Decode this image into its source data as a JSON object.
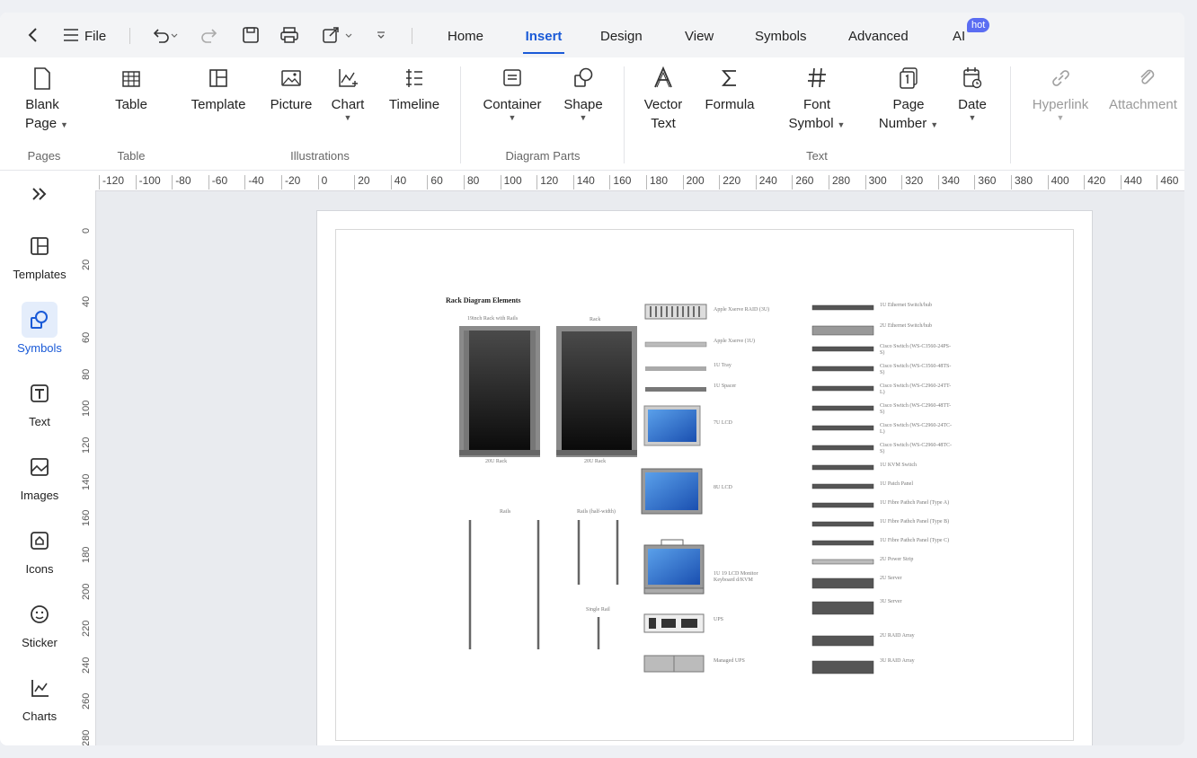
{
  "menubar": {
    "file_label": "File",
    "tabs": [
      {
        "label": "Home"
      },
      {
        "label": "Insert"
      },
      {
        "label": "Design"
      },
      {
        "label": "View"
      },
      {
        "label": "Symbols"
      },
      {
        "label": "Advanced"
      },
      {
        "label": "AI"
      }
    ],
    "hot_badge": "hot"
  },
  "ribbon": {
    "blank_page": [
      "Blank",
      "Page"
    ],
    "table": "Table",
    "template": "Template",
    "picture": "Picture",
    "chart": "Chart",
    "timeline": "Timeline",
    "container": "Container",
    "shape": "Shape",
    "vector_text": [
      "Vector",
      "Text"
    ],
    "formula": "Formula",
    "font_symbol": [
      "Font",
      "Symbol"
    ],
    "page_number": [
      "Page",
      "Number"
    ],
    "date": "Date",
    "hyperlink": "Hyperlink",
    "attachment": "Attachment",
    "groups": {
      "pages": "Pages",
      "table": "Table",
      "illustrations": "Illustrations",
      "diagram_parts": "Diagram Parts",
      "text": "Text"
    }
  },
  "sidebar": {
    "items": [
      {
        "label": "Templates",
        "icon": "templates-icon"
      },
      {
        "label": "Symbols",
        "icon": "symbols-icon"
      },
      {
        "label": "Text",
        "icon": "text-icon"
      },
      {
        "label": "Images",
        "icon": "images-icon"
      },
      {
        "label": "Icons",
        "icon": "icons-icon"
      },
      {
        "label": "Sticker",
        "icon": "sticker-icon"
      },
      {
        "label": "Charts",
        "icon": "charts-icon"
      }
    ]
  },
  "ruler": {
    "h_ticks": [
      "-120",
      "-100",
      "-80",
      "-60",
      "-40",
      "-20",
      "0",
      "20",
      "40",
      "60",
      "80",
      "100",
      "120",
      "140",
      "160",
      "180",
      "200",
      "220",
      "240",
      "260",
      "280",
      "300",
      "320",
      "340",
      "360",
      "380",
      "400",
      "420",
      "440",
      "460"
    ],
    "v_ticks": [
      "0",
      "20",
      "40",
      "60",
      "80",
      "100",
      "120",
      "140",
      "160",
      "180",
      "200",
      "220",
      "240",
      "260",
      "280"
    ]
  },
  "diagram": {
    "title": "Rack Diagram Elements",
    "rack1_caption": "19inch Rack with Rails",
    "rack2_caption": "Rack",
    "rack1_bottom": "20U Rack",
    "rack2_bottom": "20U Rack",
    "rails": "Rails",
    "rails_half": "Rails (half-width)",
    "single_rail": "Single Rail",
    "mid_labels": [
      "Apple Xserve RAID (3U)",
      "Apple Xserve (1U)",
      "1U Tray",
      "1U Spacer",
      "7U LCD",
      "8U LCD",
      "1U 19 LCD Monitor Keyboard d/KVM",
      "UPS",
      "Managed UPS"
    ],
    "right_labels": [
      "1U Ethernet Switch/hub",
      "2U Ethernet Switch/hub",
      "Cisco Switch (WS-C3560-24PS-S)",
      "Cisco Switch (WS-C3560-48TS-S)",
      "Cisco Switch (WS-C2960-24TT-L)",
      "Cisco Switch (WS-C2960-48TT-S)",
      "Cisco Switch (WS-C2960-24TC-L)",
      "Cisco Switch (WS-C2960-48TC-S)",
      "1U KVM Switch",
      "1U Patch Panel",
      "1U Fibre Pathch Panel (Type A)",
      "1U Fibre Pathch Panel (Type B)",
      "1U Fibre Pathch Panel (Type C)",
      "2U Power Strip",
      "2U Server",
      "3U Server",
      "2U RAID Array",
      "3U RAID Array"
    ]
  }
}
